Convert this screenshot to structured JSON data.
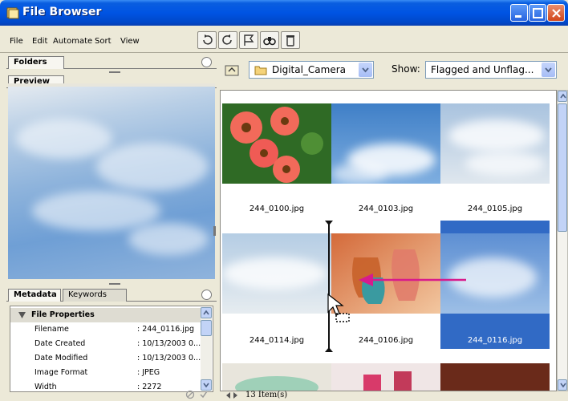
{
  "window": {
    "title": "File Browser"
  },
  "menu": [
    "File",
    "Edit",
    "Automate",
    "Sort",
    "View"
  ],
  "left": {
    "tabs_top": [
      "Folders"
    ],
    "tabs_preview": [
      "Preview"
    ],
    "tabs_meta": [
      "Metadata",
      "Keywords"
    ],
    "metadata": {
      "section": "File Properties",
      "rows": [
        {
          "key": "Filename",
          "value": ": 244_0116.jpg"
        },
        {
          "key": "Date Created",
          "value": ": 10/13/2003 0..."
        },
        {
          "key": "Date Modified",
          "value": ": 10/13/2003 0..."
        },
        {
          "key": "Image Format",
          "value": ": JPEG"
        },
        {
          "key": "Width",
          "value": ": 2272"
        }
      ]
    }
  },
  "nav": {
    "folder": "Digital_Camera",
    "show_label": "Show:",
    "show_value": "Flagged and Unflag..."
  },
  "thumbnails": [
    {
      "name": "244_0100.jpg",
      "kind": "flowers"
    },
    {
      "name": "244_0103.jpg",
      "kind": "sky-blue"
    },
    {
      "name": "244_0105.jpg",
      "kind": "sky-pale"
    },
    {
      "name": "244_0114.jpg",
      "kind": "sky-light"
    },
    {
      "name": "244_0106.jpg",
      "kind": "glassware"
    },
    {
      "name": "244_0116.jpg",
      "kind": "sky-blue",
      "selected": true
    }
  ],
  "status": {
    "items": "13 Item(s)"
  },
  "colors": {
    "selection": "#316ac5",
    "titlebar": "#0054e3",
    "arrow": "#d81b8c"
  }
}
